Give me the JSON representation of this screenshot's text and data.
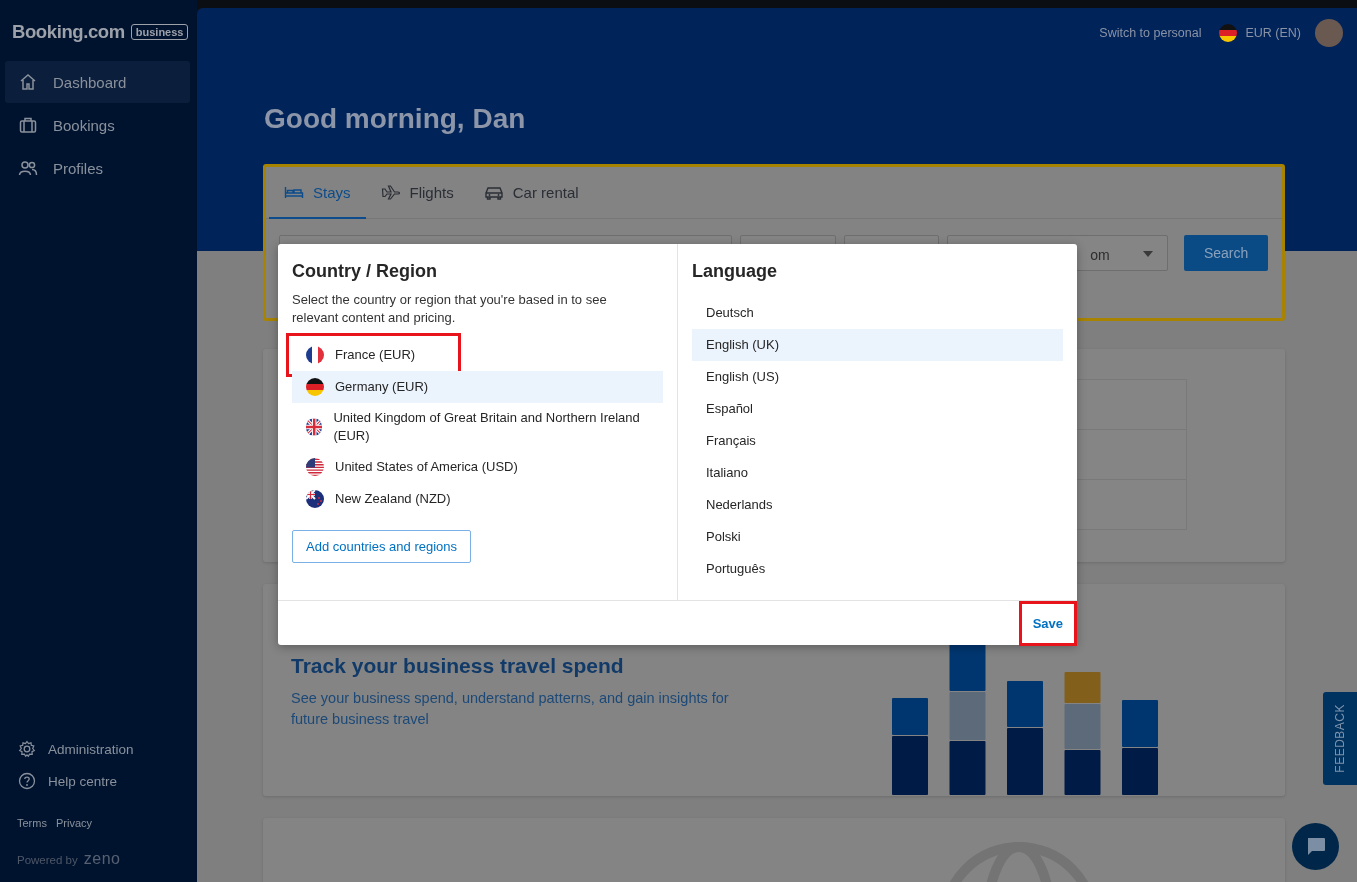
{
  "sidebar": {
    "logo": "Booking.com",
    "logo_badge": "business",
    "items": [
      {
        "label": "Dashboard",
        "selected": true
      },
      {
        "label": "Bookings",
        "selected": false
      },
      {
        "label": "Profiles",
        "selected": false
      }
    ],
    "footer_items": [
      {
        "label": "Administration"
      },
      {
        "label": "Help centre"
      }
    ],
    "links": [
      "Terms",
      "Privacy"
    ],
    "powered_by": "Powered by",
    "powered_logo": "zeno"
  },
  "header": {
    "switch_link": "Switch to personal",
    "currency": "EUR (EN)"
  },
  "greeting": "Good morning, Dan",
  "search": {
    "tabs": [
      {
        "label": "Stays",
        "selected": true
      },
      {
        "label": "Flights",
        "selected": false
      },
      {
        "label": "Car rental",
        "selected": false
      }
    ],
    "dropdown_value": "om",
    "button": "Search"
  },
  "track_card": {
    "title": "Track your business travel spend",
    "text": "See your business spend, understand patterns, and gain insights for future business travel"
  },
  "feedback": "FEEDBACK",
  "modal": {
    "country_title": "Country / Region",
    "country_description": "Select the country or region that you're based in to see relevant content and pricing.",
    "countries": [
      {
        "name": "France (EUR)",
        "selected": false,
        "annotated": true
      },
      {
        "name": "Germany (EUR)",
        "selected": true,
        "annotated": false
      },
      {
        "name": "United Kingdom of Great Britain and Northern Ireland (EUR)",
        "selected": false,
        "annotated": false
      },
      {
        "name": "United States of America (USD)",
        "selected": false,
        "annotated": false
      },
      {
        "name": "New Zealand (NZD)",
        "selected": false,
        "annotated": false
      }
    ],
    "add_button": "Add countries and regions",
    "language_title": "Language",
    "languages": [
      {
        "name": "Deutsch",
        "selected": false
      },
      {
        "name": "English (UK)",
        "selected": true
      },
      {
        "name": "English (US)",
        "selected": false
      },
      {
        "name": "Español",
        "selected": false
      },
      {
        "name": "Français",
        "selected": false
      },
      {
        "name": "Italiano",
        "selected": false
      },
      {
        "name": "Nederlands",
        "selected": false
      },
      {
        "name": "Polski",
        "selected": false
      },
      {
        "name": "Português",
        "selected": false
      }
    ],
    "save": {
      "label": "Save",
      "annotated": true
    }
  }
}
